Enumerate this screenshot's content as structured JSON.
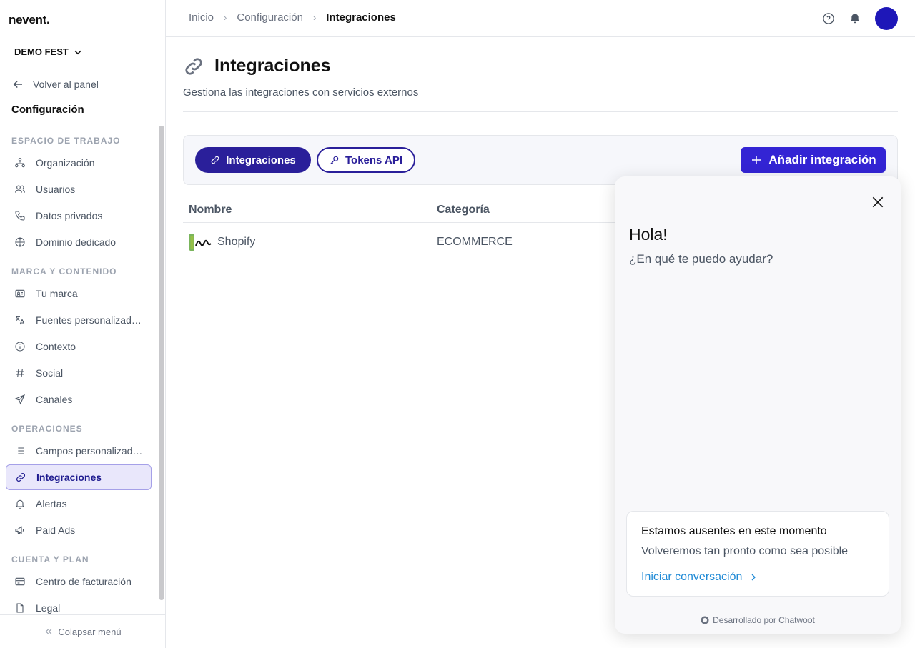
{
  "app": {
    "logo": "nevent.",
    "org_name": "DEMO FEST"
  },
  "sidebar": {
    "back_label": "Volver al panel",
    "section_title": "Configuración",
    "groups": [
      {
        "label": "ESPACIO DE TRABAJO",
        "items": [
          {
            "label": "Organización",
            "icon": "org-chart-icon"
          },
          {
            "label": "Usuarios",
            "icon": "users-icon"
          },
          {
            "label": "Datos privados",
            "icon": "phone-icon"
          },
          {
            "label": "Dominio dedicado",
            "icon": "globe-icon"
          }
        ]
      },
      {
        "label": "MARCA Y CONTENIDO",
        "items": [
          {
            "label": "Tu marca",
            "icon": "id-card-icon"
          },
          {
            "label": "Fuentes personalizad…",
            "icon": "translate-icon"
          },
          {
            "label": "Contexto",
            "icon": "info-icon"
          },
          {
            "label": "Social",
            "icon": "hashtag-icon"
          },
          {
            "label": "Canales",
            "icon": "send-icon"
          }
        ]
      },
      {
        "label": "OPERACIONES",
        "items": [
          {
            "label": "Campos personalizad…",
            "icon": "list-icon"
          },
          {
            "label": "Integraciones",
            "icon": "link-icon",
            "active": true
          },
          {
            "label": "Alertas",
            "icon": "bell-icon"
          },
          {
            "label": "Paid Ads",
            "icon": "megaphone-icon"
          }
        ]
      },
      {
        "label": "CUENTA Y PLAN",
        "items": [
          {
            "label": "Centro de facturación",
            "icon": "credit-card-icon"
          },
          {
            "label": "Legal",
            "icon": "document-icon"
          }
        ]
      }
    ],
    "collapse_label": "Colapsar menú"
  },
  "breadcrumb": {
    "items": [
      "Inicio",
      "Configuración",
      "Integraciones"
    ]
  },
  "page": {
    "title": "Integraciones",
    "subtitle": "Gestiona las integraciones con servicios externos",
    "tabs": [
      {
        "label": "Integraciones",
        "active": true
      },
      {
        "label": "Tokens API",
        "active": false
      }
    ],
    "add_button": "Añadir integración"
  },
  "table": {
    "columns": [
      "Nombre",
      "Categoría"
    ],
    "rows": [
      {
        "name": "Shopify",
        "category": "ECOMMERCE"
      }
    ]
  },
  "chat_widget": {
    "greeting": "Hola!",
    "question": "¿En qué te puedo ayudar?",
    "card_title": "Estamos ausentes en este momento",
    "card_subtitle": "Volveremos tan pronto como sea posible",
    "card_link": "Iniciar conversación",
    "footer": "Desarrollado por Chatwoot"
  },
  "colors": {
    "accent": "#2a1f9a",
    "button": "#3324d4",
    "link": "#1f8ad6",
    "active_bg": "#e9e7fb"
  }
}
